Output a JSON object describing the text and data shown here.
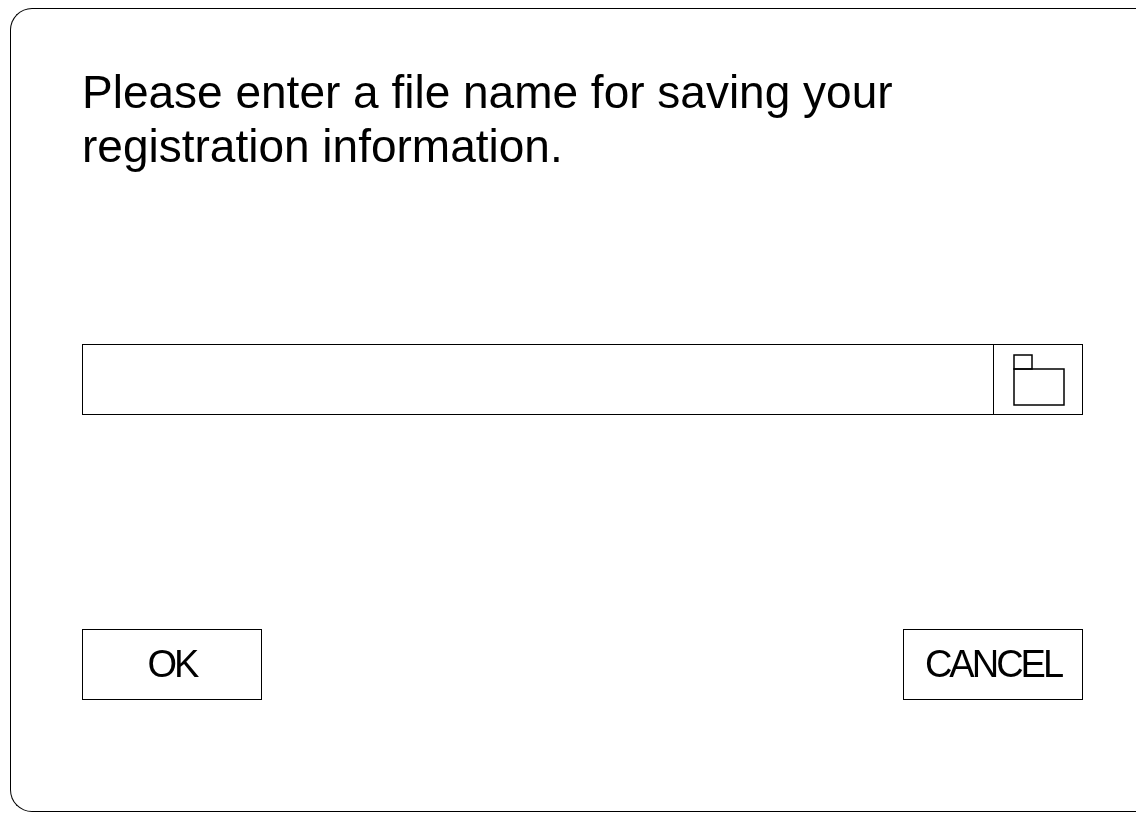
{
  "message": "Please enter a file name for saving your registration information.",
  "buttons": [
    "OK",
    "CANCEL"
  ]
}
